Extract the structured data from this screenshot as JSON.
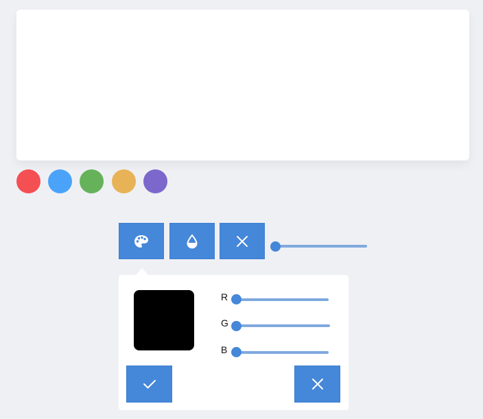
{
  "colors": {
    "accent": "#4587d9",
    "track": "#7fa9de",
    "knob": "#4587d9",
    "canvas": "#ffffff",
    "background": "#eff0f4"
  },
  "palette": [
    {
      "name": "red",
      "color": "#f44f53"
    },
    {
      "name": "blue",
      "color": "#4aa3f9"
    },
    {
      "name": "green",
      "color": "#65b25a"
    },
    {
      "name": "orange",
      "color": "#e8b356"
    },
    {
      "name": "purple",
      "color": "#7c68cc"
    }
  ],
  "toolbar": {
    "buttons": [
      {
        "icon": "palette-icon"
      },
      {
        "icon": "droplet-icon"
      },
      {
        "icon": "close-icon"
      }
    ],
    "brush_size": 0
  },
  "color_picker": {
    "preview_color": "#000000",
    "channels": [
      {
        "label": "R",
        "value": 0
      },
      {
        "label": "G",
        "value": 0
      },
      {
        "label": "B",
        "value": 0
      }
    ],
    "confirm_icon": "check-icon",
    "cancel_icon": "close-icon"
  }
}
